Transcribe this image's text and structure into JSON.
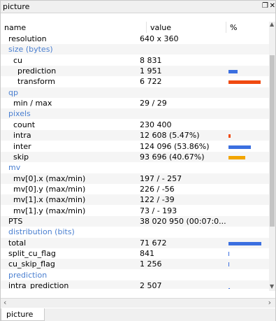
{
  "window": {
    "title": "picture"
  },
  "tab": {
    "label": "picture"
  },
  "columns": {
    "name": "name",
    "value": "value",
    "percent": "%"
  },
  "colors": {
    "section": "#4a7fd0",
    "blue": "#3b6fe0",
    "orange_red": "#f04a10",
    "amber": "#f2a500",
    "scrollbar_thumb": "#c4c4c4"
  },
  "rows": [
    {
      "name": "resolution",
      "value": "640 x 360"
    },
    {
      "name": "size (bytes)",
      "section": true
    },
    {
      "name": "cu",
      "value": "8 831"
    },
    {
      "name": "prediction",
      "value": "1 951",
      "bar_fraction": 0.22,
      "bar_color": "blue"
    },
    {
      "name": "transform",
      "value": "6 722",
      "bar_fraction": 0.76,
      "bar_color": "orange_red"
    },
    {
      "name": "qp",
      "section": true
    },
    {
      "name": "min / max",
      "value": "29 / 29"
    },
    {
      "name": "pixels",
      "section": true
    },
    {
      "name": "count",
      "value": "230 400"
    },
    {
      "name": "intra",
      "value": "12 608 (5.47%)",
      "bar_fraction": 0.055,
      "bar_color": "orange_red"
    },
    {
      "name": "inter",
      "value": "124 096 (53.86%)",
      "bar_fraction": 0.5386,
      "bar_color": "blue"
    },
    {
      "name": "skip",
      "value": "93 696 (40.67%)",
      "bar_fraction": 0.4067,
      "bar_color": "amber"
    },
    {
      "name": "mv",
      "section": true
    },
    {
      "name": "mv[0].x (max/min)",
      "value": "197 / - 257"
    },
    {
      "name": "mv[0].y (max/min)",
      "value": "226 / -56"
    },
    {
      "name": "mv[1].x (max/min)",
      "value": "122 / -39"
    },
    {
      "name": "mv[1].y (max/min)",
      "value": "73 / - 193"
    },
    {
      "name": "PTS",
      "value": "38 020 950 (00:07:0..."
    },
    {
      "name": "distribution (bits)",
      "section": true
    },
    {
      "name": "total",
      "value": "71 672",
      "bar_fraction": 0.79,
      "bar_color": "blue"
    },
    {
      "name": "split_cu_flag",
      "value": "841",
      "bar_fraction": 0.01,
      "bar_color": "blue"
    },
    {
      "name": "cu_skip_flag",
      "value": "1 256",
      "bar_fraction": 0.01,
      "bar_color": "blue"
    },
    {
      "name": "prediction",
      "section": true
    },
    {
      "name": "intra_prediction",
      "value": "2 507",
      "bar_fraction": 0.03,
      "bar_color": "blue",
      "clipped": true
    }
  ]
}
